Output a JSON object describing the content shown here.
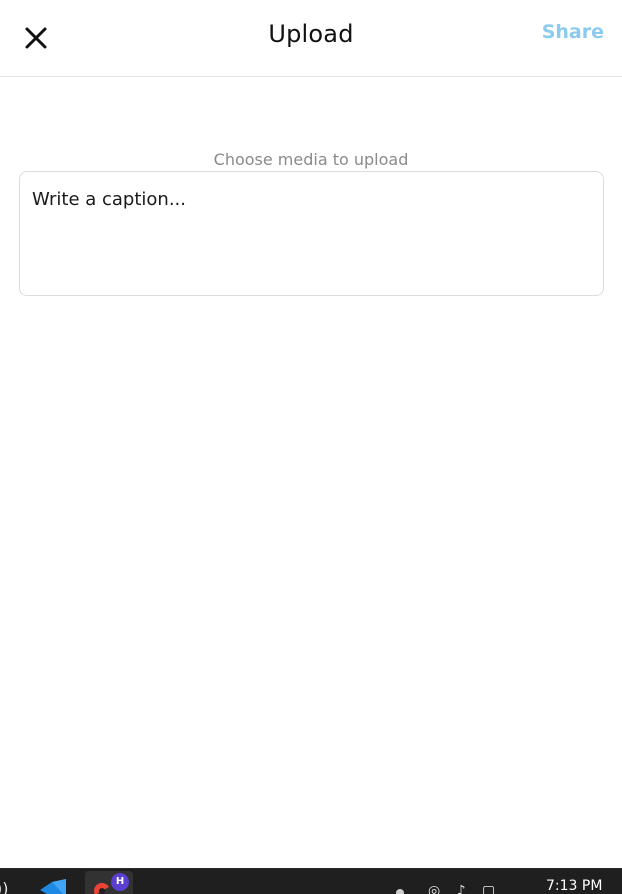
{
  "header": {
    "close_icon": "close-icon",
    "title": "Upload",
    "share_label": "Share"
  },
  "main": {
    "choose_media_label": "Choose media to upload",
    "caption_placeholder": "Write a caption...",
    "caption_value": ""
  },
  "taskbar": {
    "clock_time": "7:13 PM",
    "browser_badge": "H",
    "icons": [
      "wifi-icon",
      "vscode-icon",
      "chrome-icon",
      "network-icon",
      "volume-icon",
      "battery-icon"
    ]
  },
  "colors": {
    "share_accent": "#8ccbef",
    "muted_text": "#8a8a8a",
    "taskbar_bg": "#1f1f1f",
    "badge": "#5b3fd0"
  }
}
